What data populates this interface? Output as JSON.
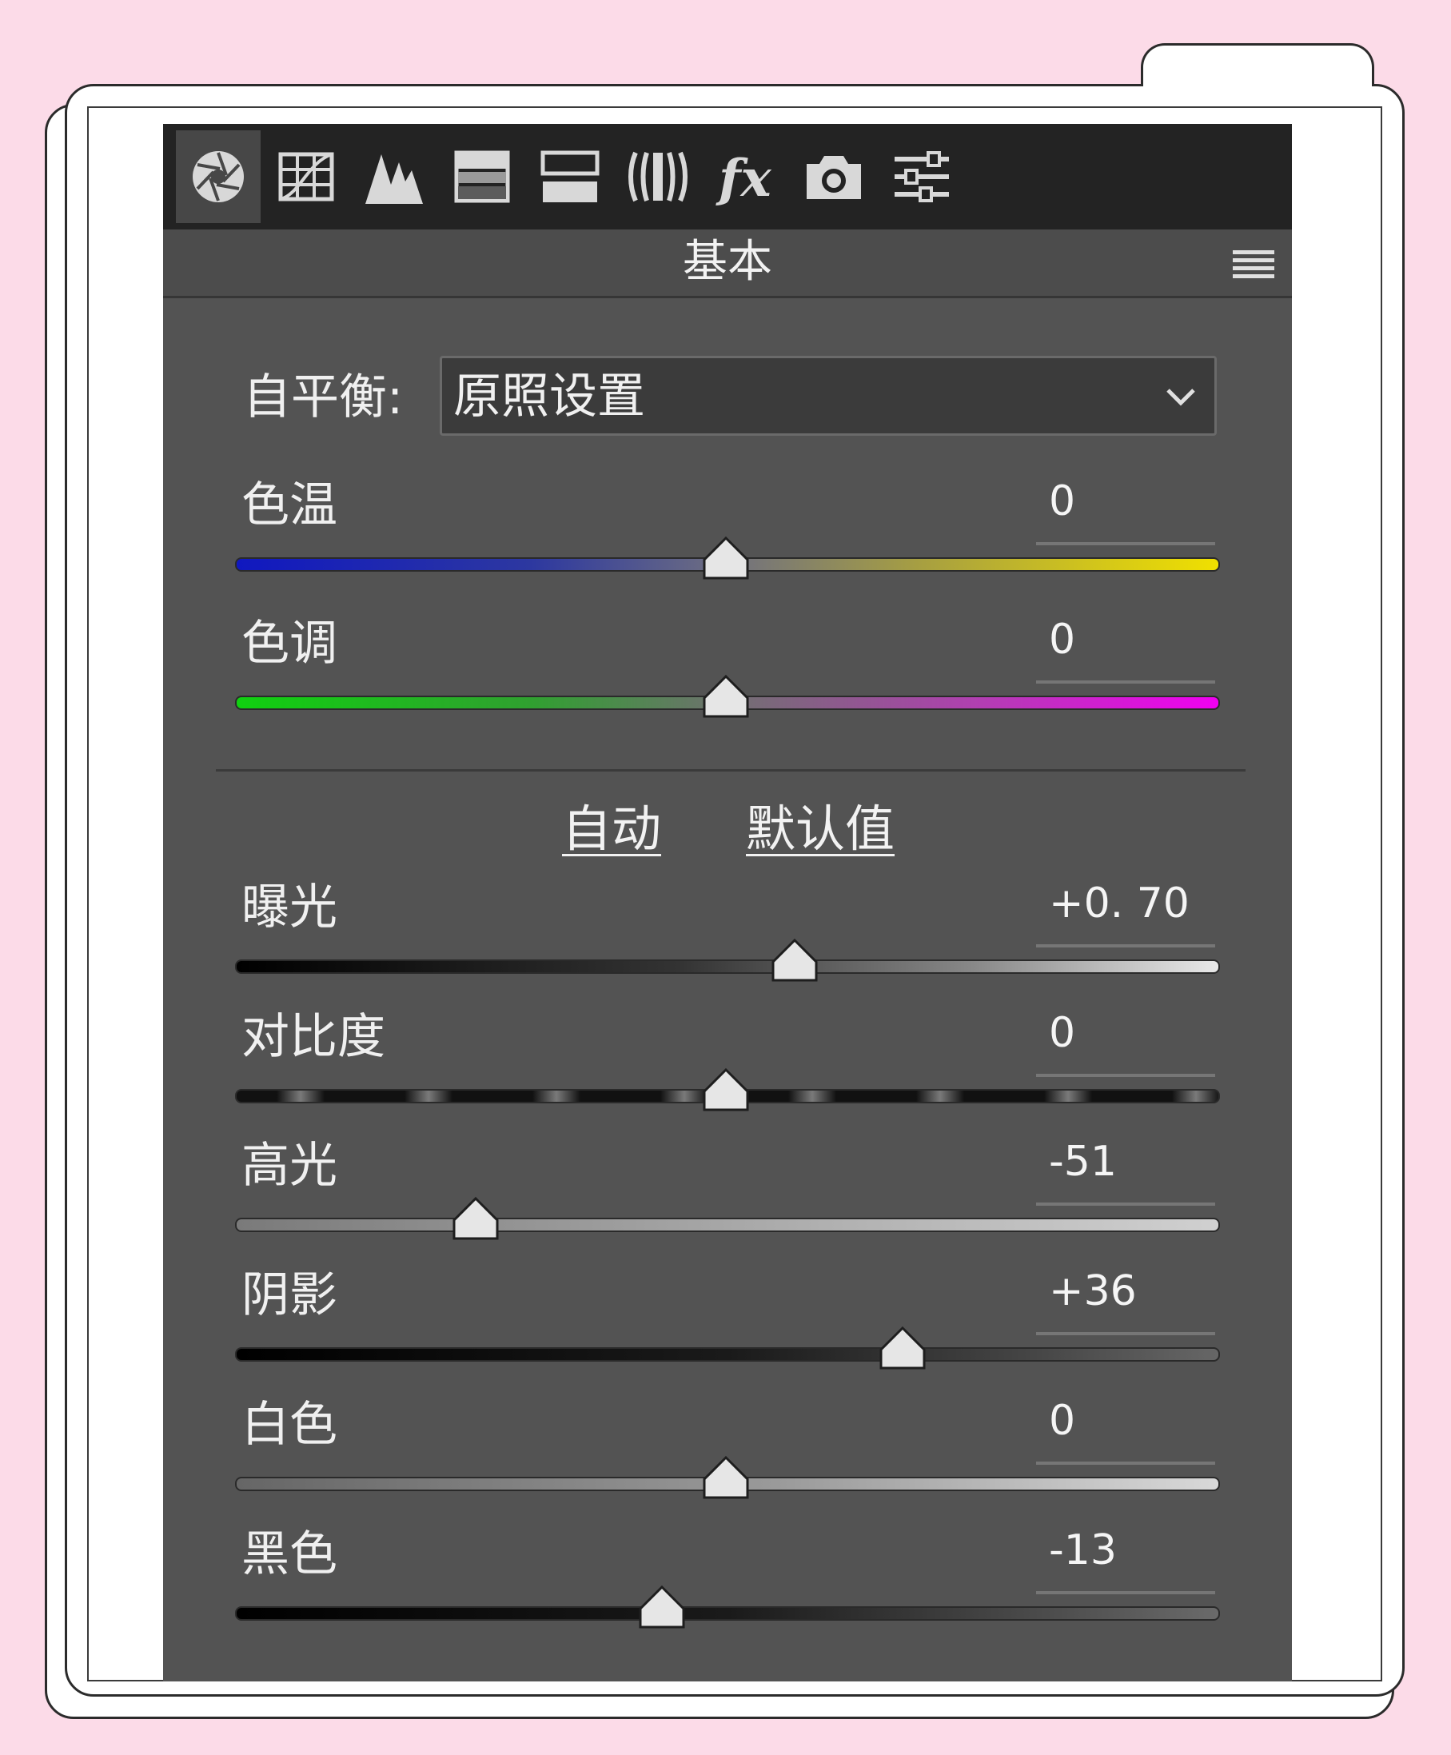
{
  "panel": {
    "title": "基本",
    "tabs": [
      {
        "icon": "aperture-icon",
        "active": true
      },
      {
        "icon": "tone-curve-grid-icon"
      },
      {
        "icon": "detail-mountains-icon"
      },
      {
        "icon": "hsl-bars-icon"
      },
      {
        "icon": "split-toning-icon"
      },
      {
        "icon": "lens-correction-icon"
      },
      {
        "icon": "fx-effects-icon"
      },
      {
        "icon": "camera-calibration-icon"
      },
      {
        "icon": "presets-sliders-icon"
      }
    ]
  },
  "white_balance": {
    "label": "自平衡:",
    "value": "原照设置"
  },
  "actions": {
    "auto": "自动",
    "default": "默认值"
  },
  "sliders": [
    {
      "id": "temperature",
      "label": "色温",
      "value": "0",
      "position": 0.5
    },
    {
      "id": "tint",
      "label": "色调",
      "value": "0",
      "position": 0.5
    },
    {
      "id": "exposure",
      "label": "曝光",
      "value": "+0. 70",
      "position": 0.57
    },
    {
      "id": "contrast",
      "label": "对比度",
      "value": "0",
      "position": 0.5
    },
    {
      "id": "highlights",
      "label": "高光",
      "value": "-51",
      "position": 0.245
    },
    {
      "id": "shadows",
      "label": "阴影",
      "value": "+36",
      "position": 0.68
    },
    {
      "id": "whites",
      "label": "白色",
      "value": "0",
      "position": 0.5
    },
    {
      "id": "blacks",
      "label": "黑色",
      "value": "-13",
      "position": 0.435
    }
  ],
  "colors": {
    "background": "#fcdbe8",
    "panel": "#535353",
    "toolbar": "#232323",
    "heart": "#f6a7c6"
  }
}
